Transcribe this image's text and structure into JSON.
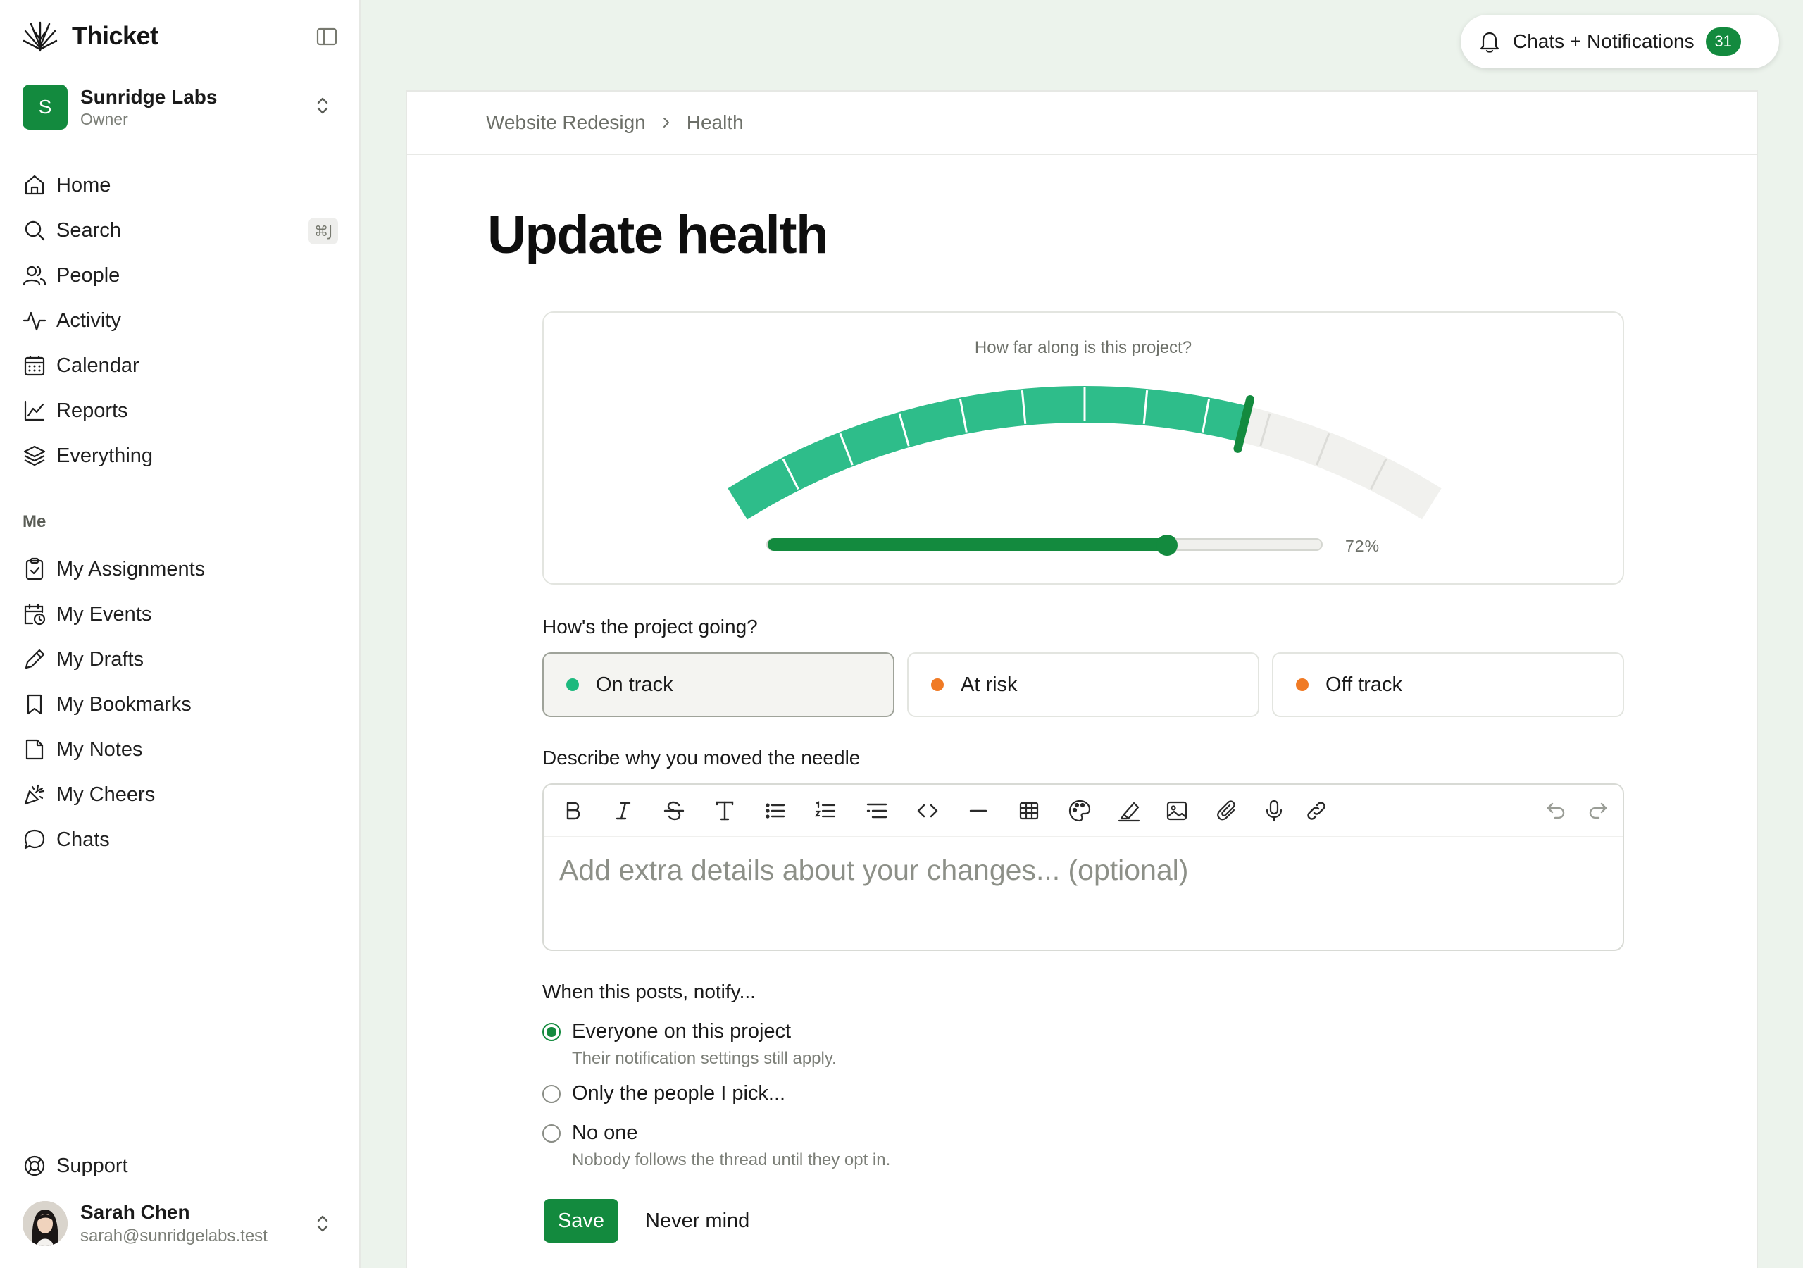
{
  "app": {
    "name": "Thicket"
  },
  "org": {
    "name": "Sunridge Labs",
    "role": "Owner",
    "initial": "S",
    "color": "#138a3e"
  },
  "nav": {
    "items": [
      {
        "label": "Home",
        "icon": "home-icon"
      },
      {
        "label": "Search",
        "icon": "search-icon",
        "shortcut": "⌘J"
      },
      {
        "label": "People",
        "icon": "people-icon"
      },
      {
        "label": "Activity",
        "icon": "activity-icon"
      },
      {
        "label": "Calendar",
        "icon": "calendar-icon"
      },
      {
        "label": "Reports",
        "icon": "chart-line-icon"
      },
      {
        "label": "Everything",
        "icon": "layers-icon"
      }
    ],
    "me_label": "Me",
    "me_items": [
      {
        "label": "My Assignments",
        "icon": "clipboard-check-icon"
      },
      {
        "label": "My Events",
        "icon": "calendar-clock-icon"
      },
      {
        "label": "My Drafts",
        "icon": "pencil-icon"
      },
      {
        "label": "My Bookmarks",
        "icon": "bookmark-icon"
      },
      {
        "label": "My Notes",
        "icon": "note-icon"
      },
      {
        "label": "My Cheers",
        "icon": "party-popper-icon"
      },
      {
        "label": "Chats",
        "icon": "chat-bubble-icon"
      }
    ],
    "support_label": "Support"
  },
  "user": {
    "name": "Sarah Chen",
    "email": "sarah@sunridgelabs.test"
  },
  "notifications": {
    "label": "Chats + Notifications",
    "count": "31"
  },
  "breadcrumb": {
    "project": "Website Redesign",
    "page": "Health"
  },
  "page": {
    "title": "Update health"
  },
  "progress": {
    "question": "How far along is this project?",
    "value": 0.72,
    "value_label": "72%",
    "fill_color": "#2ebd8a",
    "track_color": "#f1f1ee"
  },
  "status": {
    "question": "How's the project going?",
    "options": [
      {
        "label": "On track",
        "color": "#1db97e",
        "selected": true
      },
      {
        "label": "At risk",
        "color": "#f07a24",
        "selected": false
      },
      {
        "label": "Off track",
        "color": "#f07a24",
        "selected": false
      }
    ]
  },
  "editor": {
    "question": "Describe why you moved the needle",
    "placeholder": "Add extra details about your changes... (optional)",
    "tools": [
      "bold-icon",
      "italic-icon",
      "strikethrough-icon",
      "text-size-icon",
      "bullet-list-icon",
      "numbered-list-icon",
      "indent-list-icon",
      "code-icon",
      "divider-icon",
      "table-icon",
      "palette-icon",
      "highlighter-icon",
      "image-icon",
      "paperclip-icon",
      "microphone-icon",
      "link-icon",
      "undo-icon",
      "redo-icon"
    ]
  },
  "notify": {
    "question": "When this posts, notify...",
    "options": [
      {
        "label": "Everyone on this project",
        "hint": "Their notification settings still apply.",
        "selected": true
      },
      {
        "label": "Only the people I pick...",
        "hint": "",
        "selected": false
      },
      {
        "label": "No one",
        "hint": "Nobody follows the thread until they opt in.",
        "selected": false
      }
    ]
  },
  "actions": {
    "save": "Save",
    "cancel": "Never mind"
  }
}
